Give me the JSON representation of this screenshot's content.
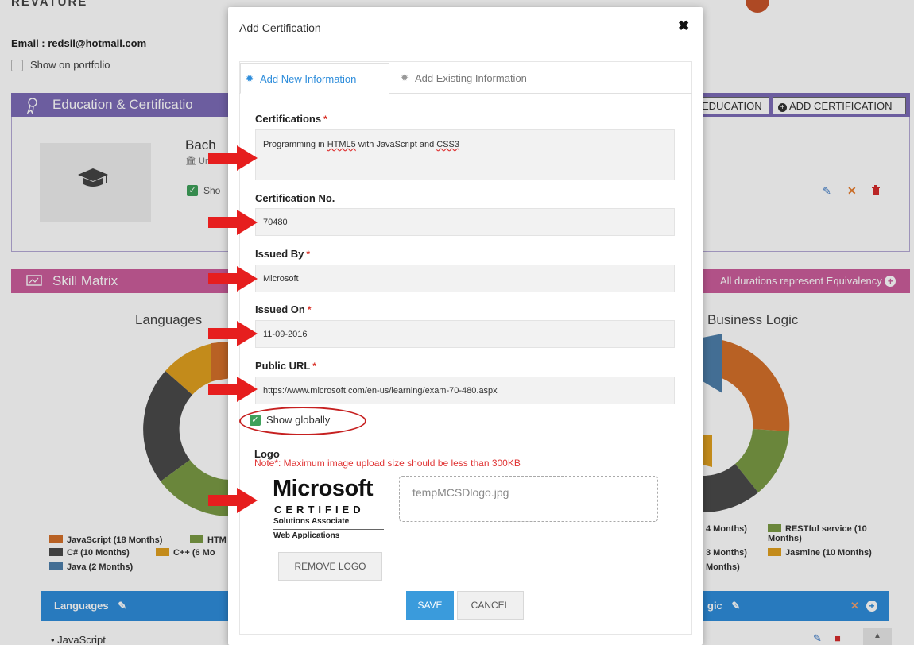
{
  "background": {
    "brand": "REVATURE",
    "email": "Email : redsil@hotmail.com",
    "show_on_portfolio": "Show on portfolio",
    "education_section_title": "Education & Certificatio",
    "degree_title": "Bach",
    "degree_sub": "Uni",
    "show_label": "Sho",
    "add_education_button": "EDUCATION",
    "add_certification_button": "ADD CERTIFICATION",
    "skill_section_title": "Skill Matrix",
    "durations_note": "All durations represent Equivalency",
    "languages_chart_title": "Languages",
    "business_chart_title": "Business Logic",
    "languages_legend": [
      {
        "label": "JavaScript (18 Months)",
        "color": "#d4702a"
      },
      {
        "label": "HTM",
        "color": "#7a9a44"
      },
      {
        "label": "C# (10 Months)",
        "color": "#4a4a4a"
      },
      {
        "label": "C++ (6 Mo",
        "color": "#e0a020"
      },
      {
        "label": "Java (2 Months)",
        "color": "#4e7faa"
      }
    ],
    "business_legend": [
      {
        "label": "4 Months)"
      },
      {
        "label": "RESTful service (10 Months)",
        "color": "#7a9a44"
      },
      {
        "label": "3 Months)"
      },
      {
        "label": "Jasmine (10 Months)",
        "color": "#e0a020"
      },
      {
        "label": "Months)"
      }
    ],
    "languages_table_title": "Languages",
    "logic_table_title": "gic",
    "languages_first_item": "JavaScript"
  },
  "modal": {
    "title": "Add Certification",
    "tabs": [
      {
        "label": "Add New Information",
        "active": true
      },
      {
        "label": "Add Existing Information",
        "active": false
      }
    ],
    "fields": {
      "certifications": {
        "label": "Certifications",
        "required": true,
        "value_parts": [
          "Programming in ",
          "HTML5",
          " with JavaScript and ",
          "CSS3"
        ]
      },
      "certification_no": {
        "label": "Certification No.",
        "required": false,
        "value": "70480"
      },
      "issued_by": {
        "label": "Issued By",
        "required": true,
        "value": "Microsoft"
      },
      "issued_on": {
        "label": "Issued On",
        "required": true,
        "value": "11-09-2016"
      },
      "public_url": {
        "label": "Public URL",
        "required": true,
        "value": "https://www.microsoft.com/en-us/learning/exam-70-480.aspx"
      }
    },
    "required_mark": "*",
    "show_globally": {
      "label": "Show globally",
      "checked": true
    },
    "logo": {
      "label": "Logo",
      "note": "Note*: Maximum image upload size should be less than 300KB",
      "image_text": {
        "brand": "Microsoft",
        "certified": "CERTIFIED",
        "line1": "Solutions Associate",
        "line2": "Web Applications"
      },
      "file_name": "tempMCSDlogo.jpg",
      "remove_button": "REMOVE LOGO"
    },
    "save_button": "SAVE",
    "cancel_button": "CANCEL"
  }
}
